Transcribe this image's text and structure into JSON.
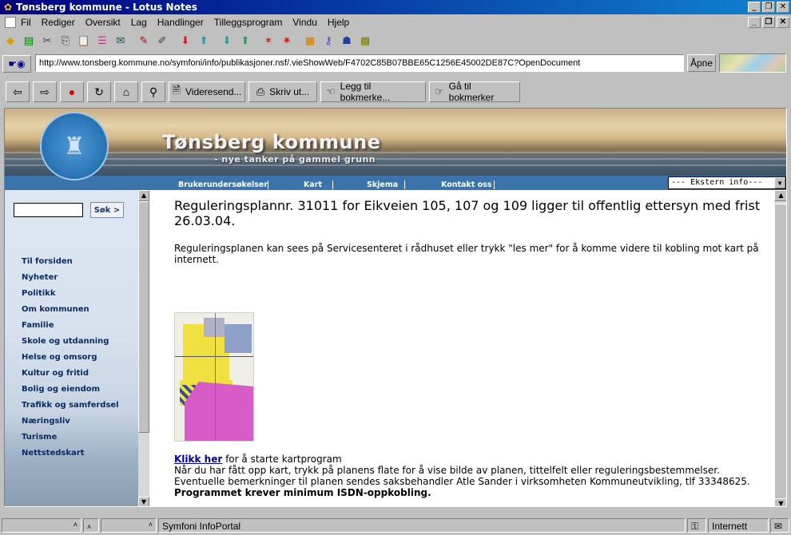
{
  "window": {
    "title": "Tønsberg kommune - Lotus Notes"
  },
  "menu": {
    "items": [
      "Fil",
      "Rediger",
      "Oversikt",
      "Lag",
      "Handlinger",
      "Tilleggsprogram",
      "Vindu",
      "Hjelp"
    ]
  },
  "address": {
    "url": "http://www.tonsberg.kommune.no/symfoni/info/publikasjoner.nsf/.vieShowWeb/F4702C85B07BBE65C1256E45002DE87C?OpenDocument",
    "open_label": "Åpne"
  },
  "navbar": {
    "forward_label": "Videresend...",
    "print_label": "Skriv ut...",
    "bookmark_label": "Legg til bokmerke...",
    "goto_label": "Gå til bokmerker"
  },
  "site": {
    "title": "Tønsberg kommune",
    "subtitle": "- nye tanker på gammel grunn",
    "topnav": [
      "Brukerundersøkelser",
      "Kart",
      "Skjema",
      "Kontakt oss"
    ],
    "external_select": "--- Ekstern info---",
    "search_button": "Søk >",
    "sidenav": [
      "Til forsiden",
      "Nyheter",
      "Politikk",
      "Om kommunen",
      "Familie",
      "Skole og utdanning",
      "Helse og omsorg",
      "Kultur og fritid",
      "Bolig og eiendom",
      "Trafikk og samferdsel",
      "Næringsliv",
      "Turisme",
      "Nettstedskart"
    ]
  },
  "article": {
    "heading": "Reguleringsplannr. 31011 for Eikveien 105, 107 og 109 ligger til offentlig ettersyn med frist 26.03.04.",
    "intro": "Reguleringsplanen kan sees på Servicesenteret i rådhuset eller trykk \"les mer\" for å komme videre til kobling mot kart på internett.",
    "link": "Klikk her",
    "link_rest": " for å starte kartprogram",
    "body": "Når du har fått opp kart, trykk på planens flate for å vise bilde av planen, tittelfelt eller reguleringsbestemmelser. Eventuelle bemerkninger til planen sendes saksbehandler Atle Sander i virksomheten Kommuneutvikling, tlf 33348625. ",
    "body_bold": "Programmet krever minimum  ISDN-oppkobling."
  },
  "status": {
    "portal": "Symfoni InfoPortal",
    "zone": "Internett"
  },
  "colors": {
    "titlebar": "#000080",
    "nav_blue": "#3b73ab",
    "link": "#0000a0",
    "zone_yellow": "#f0e040",
    "zone_magenta": "#d85cc8"
  }
}
